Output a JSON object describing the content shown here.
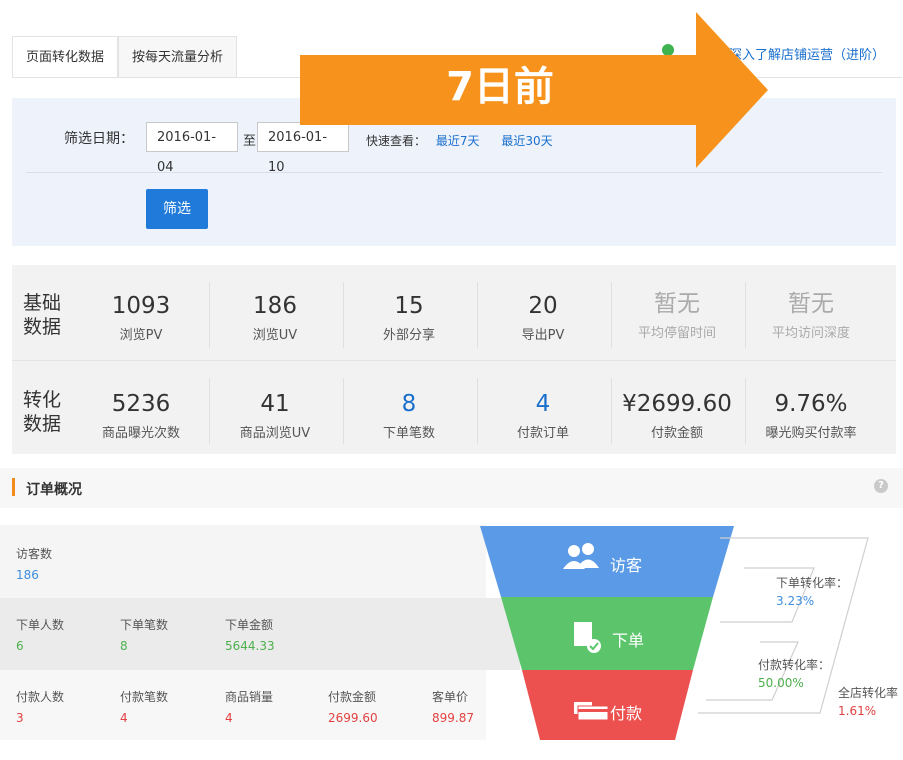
{
  "tabs": [
    {
      "label": "页面转化数据"
    },
    {
      "label": "按每天流量分析"
    }
  ],
  "top_link": "析深入了解店铺运营（进阶）",
  "banner": {
    "label": "7日前"
  },
  "filter": {
    "date_label": "筛选日期：",
    "start_date": "2016-01-04",
    "sep": "至",
    "end_date": "2016-01-10",
    "quick_label": "快速查看：",
    "quick7": "最近7天",
    "quick30": "最近30天",
    "button": "筛选"
  },
  "stats": {
    "basic_label": "基础\n数据",
    "conv_label": "转化\n数据",
    "basic": [
      {
        "value": "1093",
        "label": "浏览PV"
      },
      {
        "value": "186",
        "label": "浏览UV"
      },
      {
        "value": "15",
        "label": "外部分享"
      },
      {
        "value": "20",
        "label": "导出PV"
      },
      {
        "value": "暂无",
        "label": "平均停留时间"
      },
      {
        "value": "暂无",
        "label": "平均访问深度"
      }
    ],
    "conversion": [
      {
        "value": "5236",
        "label": "商品曝光次数"
      },
      {
        "value": "41",
        "label": "商品浏览UV"
      },
      {
        "value": "8",
        "label": "下单笔数"
      },
      {
        "value": "4",
        "label": "付款订单"
      },
      {
        "value": "¥2699.60",
        "label": "付款金额"
      },
      {
        "value": "9.76%",
        "label": "曝光购买付款率"
      }
    ]
  },
  "order": {
    "title": "订单概况",
    "help": "?",
    "visitors": {
      "label": "访客数",
      "value": "186"
    },
    "placed": [
      {
        "label": "下单人数",
        "value": "6"
      },
      {
        "label": "下单笔数",
        "value": "8"
      },
      {
        "label": "下单金额",
        "value": "5644.33"
      }
    ],
    "paid": [
      {
        "label": "付款人数",
        "value": "3"
      },
      {
        "label": "付款笔数",
        "value": "4"
      },
      {
        "label": "商品销量",
        "value": "4"
      },
      {
        "label": "付款金额",
        "value": "2699.60"
      },
      {
        "label": "客单价",
        "value": "899.87"
      }
    ],
    "funnel": {
      "visit": "访客",
      "order": "下单",
      "pay": "付款"
    },
    "rates": {
      "order_rate_label": "下单转化率：",
      "order_rate": "3.23%",
      "pay_rate_label": "付款转化率：",
      "pay_rate": "50.00%",
      "store_rate_label": "全店转化率",
      "store_rate": "1.61%"
    },
    "colors": {
      "visit": "#5b9ae6",
      "order": "#5cc56b",
      "pay": "#ec5150",
      "banner": "#f7931d"
    }
  }
}
